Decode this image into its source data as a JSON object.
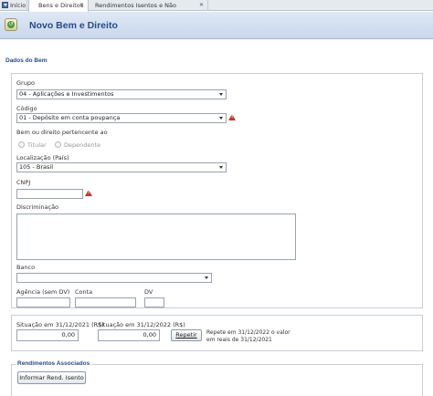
{
  "tabs": [
    {
      "label": "Início",
      "closable": false
    },
    {
      "label": "Bens e Direitos",
      "closable": true
    },
    {
      "label": "Rendimentos Isentos e Não Tributáveis",
      "closable": true
    }
  ],
  "header": {
    "title": "Novo Bem e Direito"
  },
  "dados_do_bem": {
    "section_title": "Dados do Bem",
    "grupo": {
      "label": "Grupo",
      "value": "04 - Aplicações e Investimentos"
    },
    "codigo": {
      "label": "Código",
      "value": "01 - Depósito em conta poupança"
    },
    "pertencente": {
      "label": "Bem ou direito pertencente ao",
      "options": [
        "Titular",
        "Dependente"
      ]
    },
    "localizacao": {
      "label": "Localização (País)",
      "value": "105 - Brasil"
    },
    "cnpj": {
      "label": "CNPJ",
      "value": ""
    },
    "discriminacao": {
      "label": "Discriminação",
      "value": ""
    },
    "banco": {
      "label": "Banco",
      "value": ""
    },
    "agencia": {
      "label": "Agência (sem DV)",
      "value": ""
    },
    "conta": {
      "label": "Conta",
      "value": ""
    },
    "dv": {
      "label": "DV",
      "value": ""
    }
  },
  "situacao": {
    "s2021": {
      "label": "Situação em 31/12/2021 (R$)",
      "value": "0,00"
    },
    "s2022": {
      "label": "Situação em 31/12/2022 (R$)",
      "value": "0,00"
    },
    "repetir_label": "Repetir",
    "repetir_note": "Repete em 31/12/2022 o valor em reais de 31/12/2021"
  },
  "rendimentos": {
    "section_title": "Rendimentos Associados",
    "button_label": "Informar Rend. Isento"
  },
  "colors": {
    "accent": "#2a4a86",
    "warning": "#c0392b",
    "header_bg": "#c9d8ec"
  }
}
